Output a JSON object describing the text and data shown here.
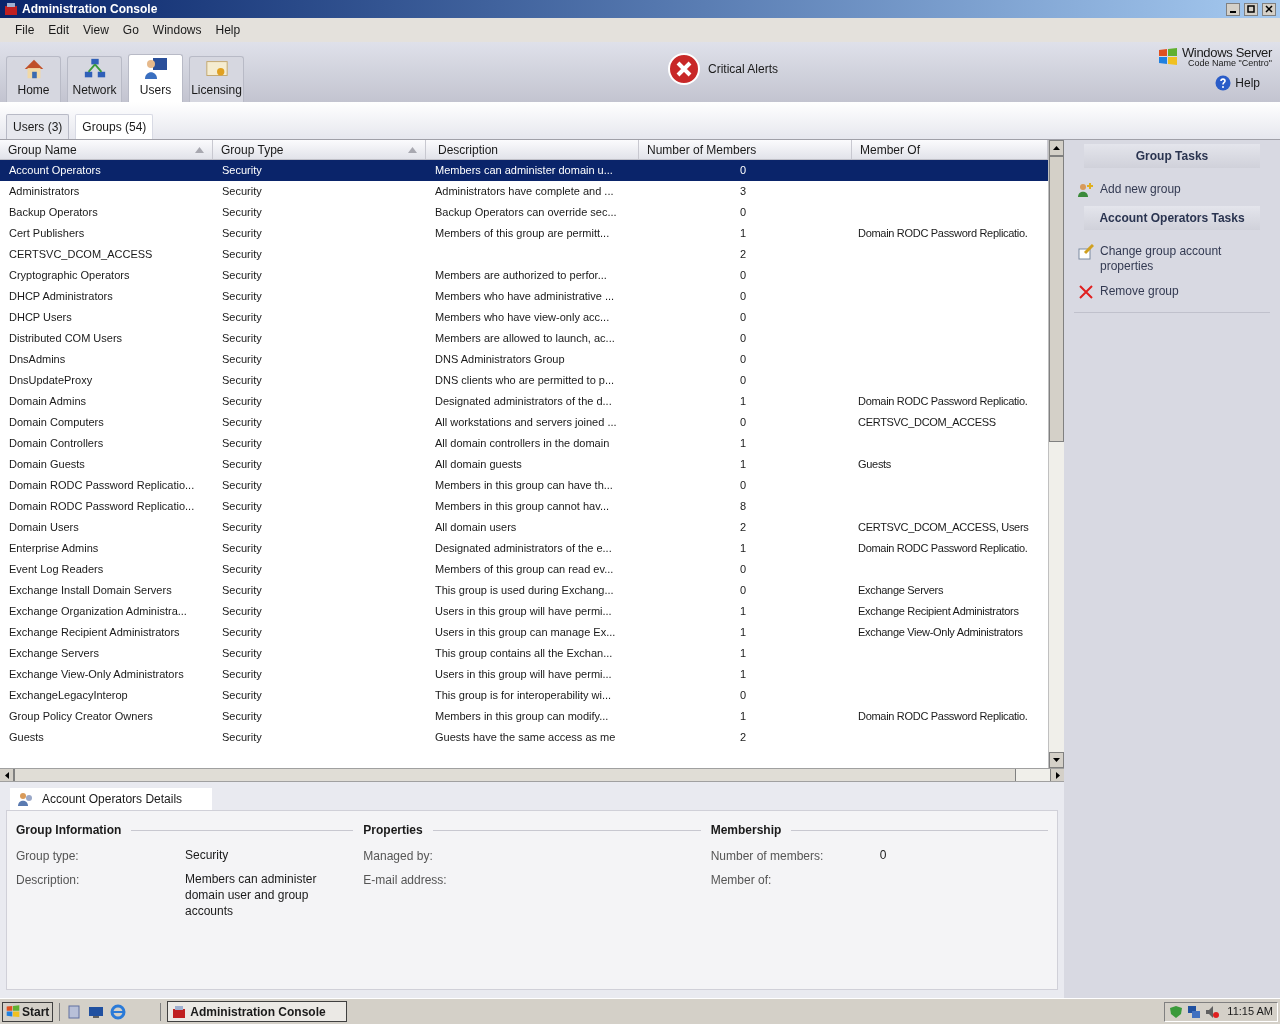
{
  "window": {
    "title": "Administration Console"
  },
  "menu": [
    "File",
    "Edit",
    "View",
    "Go",
    "Windows",
    "Help"
  ],
  "toolbar": [
    {
      "label": "Home",
      "kind": "home",
      "selected": false
    },
    {
      "label": "Network",
      "kind": "network",
      "selected": false
    },
    {
      "label": "Users",
      "kind": "users",
      "selected": true
    },
    {
      "label": "Licensing",
      "kind": "licensing",
      "selected": false
    }
  ],
  "alert": {
    "label": "Critical Alerts"
  },
  "brand": {
    "name": "Windows Server",
    "subtitle": "Code Name \"Centro\""
  },
  "help": "Help",
  "tabs": [
    {
      "label": "Users (3)",
      "selected": false
    },
    {
      "label": "Groups (54)",
      "selected": true
    }
  ],
  "table": {
    "columns": [
      "Group Name",
      "Group Type",
      "Description",
      "Number of Members",
      "Member Of"
    ],
    "rows": [
      {
        "cells": [
          "Account Operators",
          "Security",
          "Members can administer domain u...",
          "0",
          ""
        ],
        "selected": true
      },
      {
        "cells": [
          "Administrators",
          "Security",
          "Administrators have complete and ...",
          "3",
          ""
        ],
        "selected": false
      },
      {
        "cells": [
          "Backup Operators",
          "Security",
          "Backup Operators can override sec...",
          "0",
          ""
        ],
        "selected": false
      },
      {
        "cells": [
          "Cert Publishers",
          "Security",
          "Members of this group are permitt...",
          "1",
          "Domain RODC Password Replicatio."
        ],
        "selected": false
      },
      {
        "cells": [
          "CERTSVC_DCOM_ACCESS",
          "Security",
          "",
          "2",
          ""
        ],
        "selected": false
      },
      {
        "cells": [
          "Cryptographic Operators",
          "Security",
          "Members are authorized to perfor...",
          "0",
          ""
        ],
        "selected": false
      },
      {
        "cells": [
          "DHCP Administrators",
          "Security",
          "Members who have administrative ...",
          "0",
          ""
        ],
        "selected": false
      },
      {
        "cells": [
          "DHCP Users",
          "Security",
          "Members who have view-only acc...",
          "0",
          ""
        ],
        "selected": false
      },
      {
        "cells": [
          "Distributed COM Users",
          "Security",
          "Members are allowed to launch, ac...",
          "0",
          ""
        ],
        "selected": false
      },
      {
        "cells": [
          "DnsAdmins",
          "Security",
          "DNS Administrators Group",
          "0",
          ""
        ],
        "selected": false
      },
      {
        "cells": [
          "DnsUpdateProxy",
          "Security",
          "DNS clients who are permitted to p...",
          "0",
          ""
        ],
        "selected": false
      },
      {
        "cells": [
          "Domain Admins",
          "Security",
          "Designated administrators of the d...",
          "1",
          "Domain RODC Password Replicatio."
        ],
        "selected": false
      },
      {
        "cells": [
          "Domain Computers",
          "Security",
          "All workstations and servers joined ...",
          "0",
          "CERTSVC_DCOM_ACCESS"
        ],
        "selected": false
      },
      {
        "cells": [
          "Domain Controllers",
          "Security",
          "All domain controllers in the domain",
          "1",
          ""
        ],
        "selected": false
      },
      {
        "cells": [
          "Domain Guests",
          "Security",
          "All domain guests",
          "1",
          "Guests"
        ],
        "selected": false
      },
      {
        "cells": [
          "Domain RODC Password Replicatio...",
          "Security",
          "Members in this group can have th...",
          "0",
          ""
        ],
        "selected": false
      },
      {
        "cells": [
          "Domain RODC Password Replicatio...",
          "Security",
          "Members in this group cannot hav...",
          "8",
          ""
        ],
        "selected": false
      },
      {
        "cells": [
          "Domain Users",
          "Security",
          "All domain users",
          "2",
          "CERTSVC_DCOM_ACCESS, Users"
        ],
        "selected": false
      },
      {
        "cells": [
          "Enterprise Admins",
          "Security",
          "Designated administrators of the e...",
          "1",
          "Domain RODC Password Replicatio."
        ],
        "selected": false
      },
      {
        "cells": [
          "Event Log Readers",
          "Security",
          "Members of this group can read ev...",
          "0",
          ""
        ],
        "selected": false
      },
      {
        "cells": [
          "Exchange Install Domain Servers",
          "Security",
          "This group is used during Exchang...",
          "0",
          "Exchange Servers"
        ],
        "selected": false
      },
      {
        "cells": [
          "Exchange Organization Administra...",
          "Security",
          "Users in this group will have permi...",
          "1",
          "Exchange Recipient Administrators"
        ],
        "selected": false
      },
      {
        "cells": [
          "Exchange Recipient Administrators",
          "Security",
          "Users in this group can manage Ex...",
          "1",
          "Exchange View-Only Administrators"
        ],
        "selected": false
      },
      {
        "cells": [
          "Exchange Servers",
          "Security",
          "This group contains all the Exchan...",
          "1",
          ""
        ],
        "selected": false
      },
      {
        "cells": [
          "Exchange View-Only Administrators",
          "Security",
          "Users in this group will have permi...",
          "1",
          ""
        ],
        "selected": false
      },
      {
        "cells": [
          "ExchangeLegacyInterop",
          "Security",
          "This group is for interoperability wi...",
          "0",
          ""
        ],
        "selected": false
      },
      {
        "cells": [
          "Group Policy Creator Owners",
          "Security",
          "Members in this group can modify...",
          "1",
          "Domain RODC Password Replicatio."
        ],
        "selected": false
      },
      {
        "cells": [
          "Guests",
          "Security",
          "Guests have the same access as me",
          "2",
          ""
        ],
        "selected": false
      }
    ]
  },
  "tasks": [
    {
      "title": "Group Tasks",
      "items": [
        {
          "label": "Add new group",
          "kind": "add"
        }
      ]
    },
    {
      "title": "Account Operators Tasks",
      "items": [
        {
          "label": "Change group account properties",
          "kind": "edit"
        },
        {
          "label": "Remove group",
          "kind": "remove"
        }
      ]
    }
  ],
  "details": {
    "tab": "Account Operators Details",
    "sections": [
      {
        "title": "Group Information",
        "fields": [
          {
            "label": "Group type:",
            "value": "Security"
          },
          {
            "label": "Description:",
            "value": "Members can administer domain user and group accounts"
          }
        ]
      },
      {
        "title": "Properties",
        "fields": [
          {
            "label": "Managed by:"
          },
          {
            "label": "E-mail address:"
          }
        ]
      },
      {
        "title": "Membership",
        "fields": [
          {
            "label": "Number of members:",
            "value": "0"
          },
          {
            "label": "Member of:"
          }
        ]
      }
    ]
  },
  "taskbar": {
    "start": "Start",
    "apps": [
      {
        "label": "Administration Console",
        "selected": true
      }
    ],
    "clock": "11:15 AM"
  }
}
